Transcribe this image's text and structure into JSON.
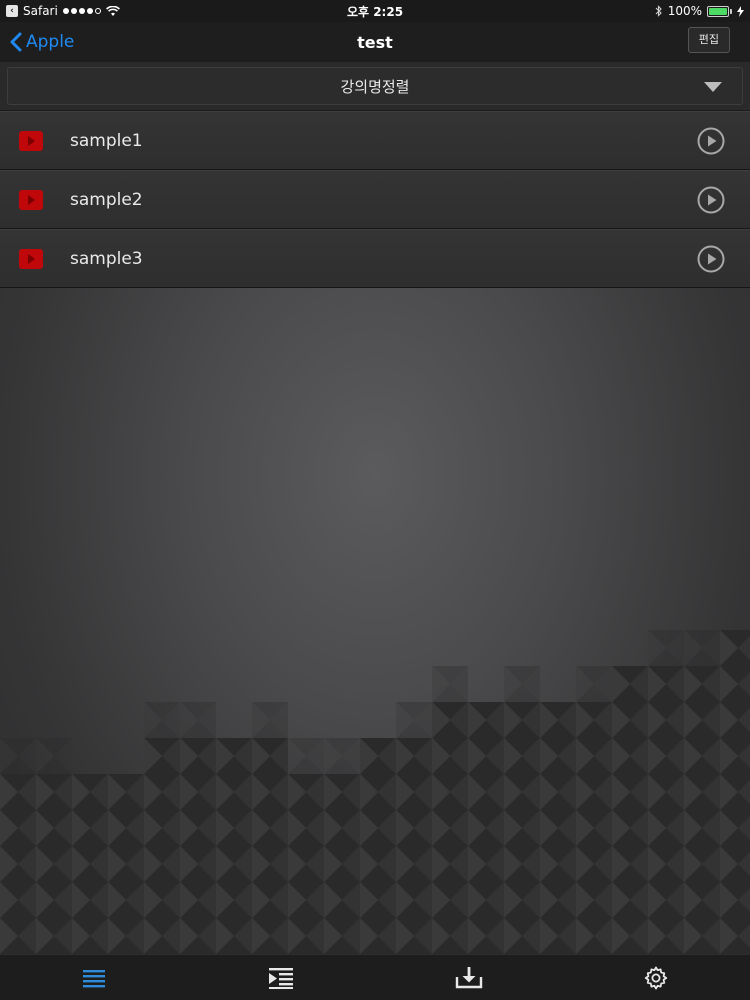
{
  "status_bar": {
    "app": "Safari",
    "time": "오후 2:25",
    "battery": "100%",
    "battery_level": 1.0,
    "signal_dots_filled": 4,
    "signal_dots_total": 5
  },
  "nav": {
    "back_label": "Apple",
    "title": "test",
    "edit_label": "편집"
  },
  "sort": {
    "label": "강의명정렬"
  },
  "list": {
    "items": [
      {
        "label": "sample1"
      },
      {
        "label": "sample2"
      },
      {
        "label": "sample3"
      }
    ]
  },
  "tabs": [
    {
      "icon": "list-icon",
      "active": true
    },
    {
      "icon": "playlist-icon",
      "active": false
    },
    {
      "icon": "download-icon",
      "active": false
    },
    {
      "icon": "gear-icon",
      "active": false
    }
  ],
  "colors": {
    "accent": "#1f8bf2",
    "active_tab": "#2f8bd8",
    "inactive_tab": "#e8e8e8",
    "video_icon": "#c0070a"
  }
}
